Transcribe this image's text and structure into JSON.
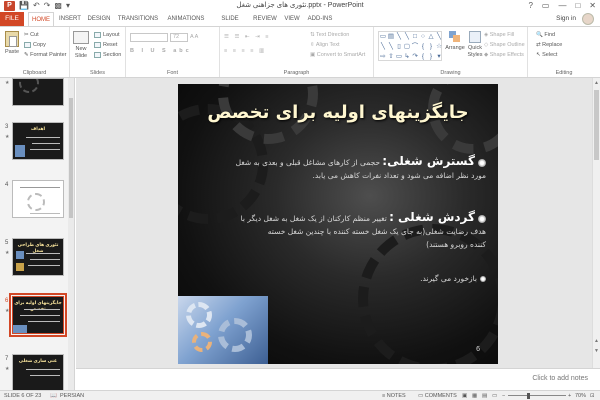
{
  "titlebar": {
    "app_icon": "P",
    "title": "تئوری های جزاهنی شغل.pptx - PowerPoint",
    "qa_icons": [
      "save-icon",
      "undo-icon",
      "redo-icon",
      "start-from-beginning-icon",
      "customize-qat-icon"
    ],
    "window_controls": [
      "?",
      "▭",
      "—",
      "□",
      "✕"
    ]
  },
  "tabs": {
    "file": "FILE",
    "items": [
      "HOME",
      "INSERT",
      "DESIGN",
      "TRANSITIONS",
      "ANIMATIONS",
      "SLIDE SHOW",
      "REVIEW",
      "VIEW",
      "ADD-INS"
    ],
    "active": "HOME",
    "signin": "Sign in"
  },
  "ribbon": {
    "clipboard": {
      "paste": "Paste",
      "cut": "Cut",
      "copy": "Copy",
      "format_painter": "Format Painter",
      "label": "Clipboard"
    },
    "slides": {
      "new_slide": "New Slide",
      "layout": "Layout",
      "reset": "Reset",
      "section": "Section",
      "label": "Slides"
    },
    "font": {
      "font_size": "72",
      "label": "Font"
    },
    "paragraph": {
      "text_direction": "Text Direction",
      "align_text": "Align Text",
      "convert_smartart": "Convert to SmartArt",
      "label": "Paragraph"
    },
    "drawing": {
      "arrange": "Arrange",
      "quick_styles": "Quick Styles",
      "shape_fill": "Shape Fill",
      "shape_outline": "Shape Outline",
      "shape_effects": "Shape Effects",
      "label": "Drawing"
    },
    "editing": {
      "find": "Find",
      "replace": "Replace",
      "select": "Select",
      "label": "Editing"
    }
  },
  "thumbnails": [
    {
      "num": "",
      "title": ""
    },
    {
      "num": "3",
      "title": "اهداف"
    },
    {
      "num": "4",
      "title": ""
    },
    {
      "num": "5",
      "title": "تئوری های طراحی شغل"
    },
    {
      "num": "6",
      "title": "جایگزینهای اولیه برای تخصص"
    },
    {
      "num": "7",
      "title": "غنی سازی شغلی"
    }
  ],
  "slide": {
    "title": "جایگزینهای اولیه برای تخصص",
    "p1_head": "گسترش شغلی:",
    "p1_line1": "حجمی از کارهای مشاغل قبلی و بعدی به شغل",
    "p1_line2": "مورد نظر اضافه می شود و تعداد نفرات کاهش می یابد.",
    "p2_head": "گردش شغلی :",
    "p2_line1": "تغییر منظم کارکنان از یک شغل به شغل دیگر با",
    "p2_line2": "هدف رضایت شغلی(به جای یک شغل خسته کننده با چندین شغل خسته",
    "p2_line3": "کننده روبرو هستند)",
    "p3": "بازخورد می گیرند.",
    "number": "6"
  },
  "notes": {
    "placeholder": "Click to add notes"
  },
  "status": {
    "slide_of": "SLIDE 6 OF 23",
    "language": "PERSIAN",
    "notes": "NOTES",
    "comments": "COMMENTS",
    "zoom": "70%",
    "zoom_value": 0.7
  },
  "colors": {
    "accent": "#d24726",
    "title_text": "#fff7d0"
  }
}
